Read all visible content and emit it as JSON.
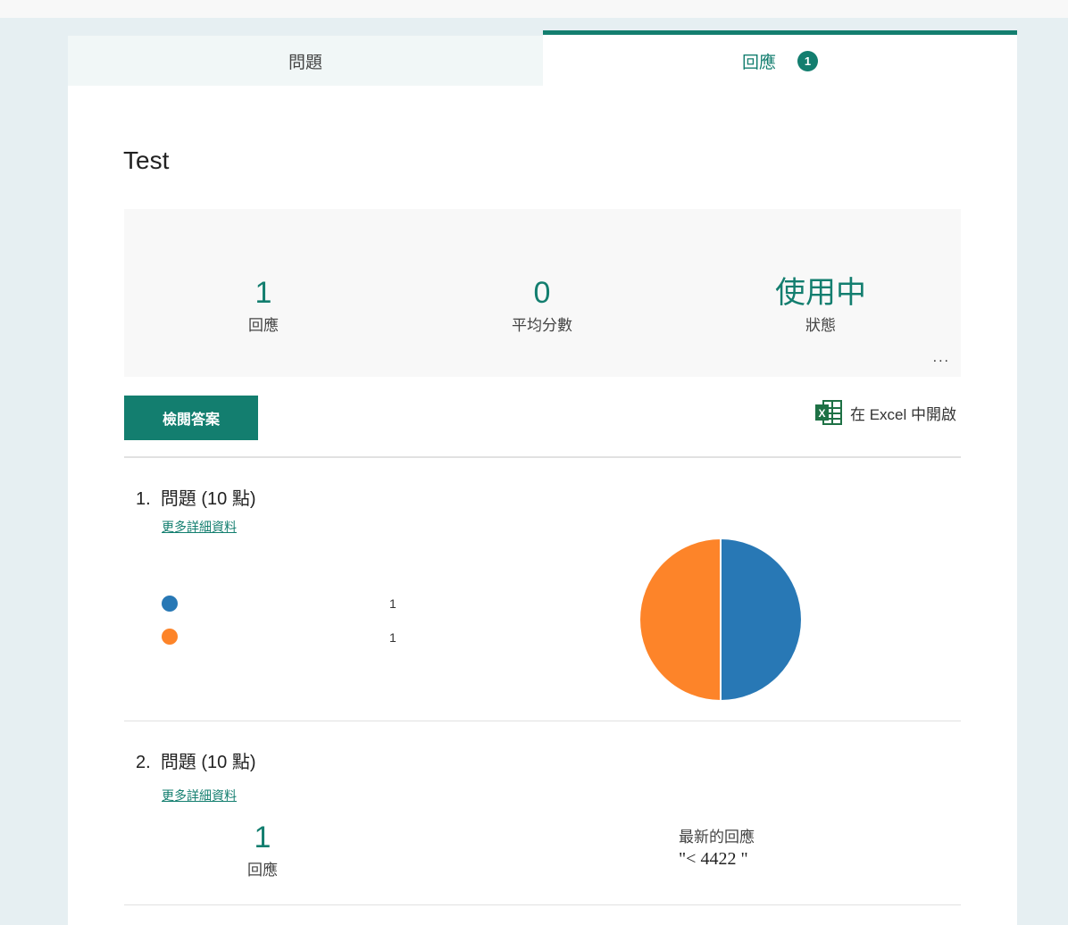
{
  "tabs": {
    "questions": "問題",
    "responses": "回應",
    "responses_badge": "1"
  },
  "form_title": "Test",
  "stats": [
    {
      "value": "1",
      "label": "回應"
    },
    {
      "value": "0",
      "label": "平均分數"
    },
    {
      "value": "使用中",
      "label": "狀態"
    }
  ],
  "more_label": "...",
  "review_button": "檢閱答案",
  "excel_label": "在 Excel 中開啟",
  "colors": {
    "accent": "#137e6f",
    "blue": "#2878b5",
    "orange": "#fd8429"
  },
  "questions": [
    {
      "number": "1.",
      "title": "問題 (10 點)",
      "details_link": "更多詳細資料",
      "chart_data": {
        "type": "pie",
        "series": [
          {
            "name": "",
            "value": 1,
            "color": "#2878b5"
          },
          {
            "name": "",
            "value": 1,
            "color": "#fd8429"
          }
        ]
      }
    },
    {
      "number": "2.",
      "title": "問題 (10 點)",
      "details_link": "更多詳細資料",
      "count": "1",
      "count_label": "回應",
      "latest_label": "最新的回應",
      "latest_value": "\"< 4422 \""
    }
  ]
}
